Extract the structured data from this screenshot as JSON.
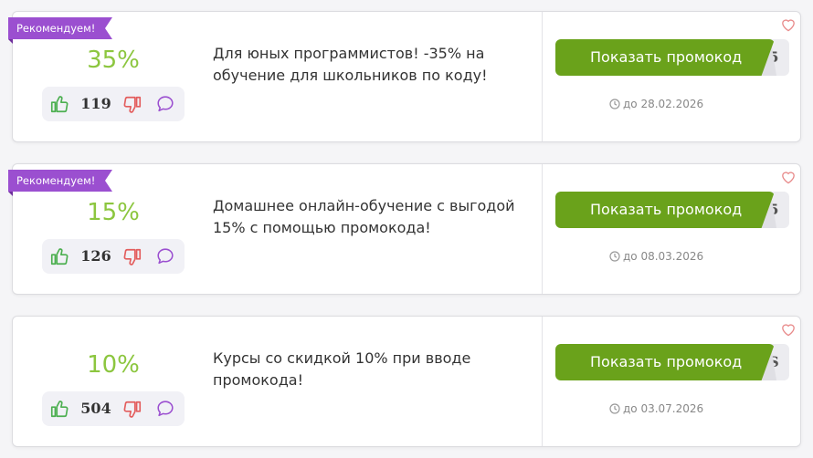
{
  "colors": {
    "accent_green": "#6aa21b",
    "percent_green": "#8cc63f",
    "ribbon_purple": "#9b4fd0",
    "thumb_up": "#4caf50",
    "thumb_down": "#e35d5d",
    "comment": "#9b4fd0",
    "heart": "#e88a8a"
  },
  "coupons": [
    {
      "badge": "Рекомендуем!",
      "percent": "35%",
      "votes": "119",
      "description": "Для юных программистов! -35% на обучение для школьников по коду!",
      "button_label": "Показать промокод",
      "code_peek": "5",
      "expiry": "до 28.02.2026"
    },
    {
      "badge": "Рекомендуем!",
      "percent": "15%",
      "votes": "126",
      "description": "Домашнее онлайн-обучение с выгодой 15% с помощью промокода!",
      "button_label": "Показать промокод",
      "code_peek": "5",
      "expiry": "до 08.03.2026"
    },
    {
      "badge": "",
      "percent": "10%",
      "votes": "504",
      "description": "Курсы со скидкой 10% при вводе промокода!",
      "button_label": "Показать промокод",
      "code_peek": "S",
      "expiry": "до 03.07.2026"
    }
  ]
}
